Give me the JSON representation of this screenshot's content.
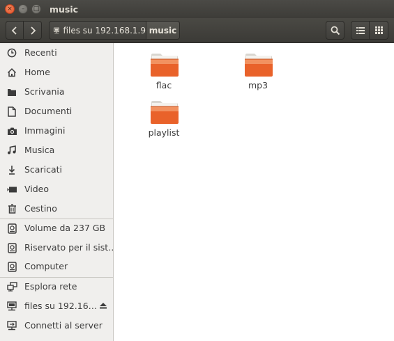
{
  "window": {
    "title": "music",
    "buttons": {
      "close": "×",
      "minimize": "–",
      "maximize": "□"
    }
  },
  "toolbar": {
    "breadcrumb": [
      {
        "label": "files su 192.168.1.9",
        "icon": "network-drive-icon"
      },
      {
        "label": "music",
        "current": true
      }
    ],
    "icons": [
      "back-icon",
      "forward-icon",
      "search-icon",
      "list-view-icon",
      "grid-view-icon"
    ]
  },
  "sidebar": {
    "items": [
      {
        "label": "Recenti",
        "icon": "clock-icon"
      },
      {
        "label": "Home",
        "icon": "home-icon"
      },
      {
        "label": "Scrivania",
        "icon": "desktop-folder-icon"
      },
      {
        "label": "Documenti",
        "icon": "document-icon"
      },
      {
        "label": "Immagini",
        "icon": "camera-icon"
      },
      {
        "label": "Musica",
        "icon": "music-note-icon"
      },
      {
        "label": "Scaricati",
        "icon": "download-icon"
      },
      {
        "label": "Video",
        "icon": "video-icon"
      },
      {
        "label": "Cestino",
        "icon": "trash-icon"
      },
      {
        "label": "Volume da 237 GB",
        "icon": "drive-icon"
      },
      {
        "label": "Riservato per il sist…",
        "icon": "drive-icon"
      },
      {
        "label": "Computer",
        "icon": "drive-icon"
      },
      {
        "label": "Esplora rete",
        "icon": "network-icon"
      },
      {
        "label": "files su 192.16…",
        "icon": "network-drive-icon",
        "eject": true
      },
      {
        "label": "Connetti al server",
        "icon": "server-connect-icon"
      }
    ]
  },
  "files": [
    {
      "name": "flac",
      "type": "folder"
    },
    {
      "name": "mp3",
      "type": "folder"
    },
    {
      "name": "playlist",
      "type": "folder"
    }
  ],
  "colors": {
    "folder": "#e9622a",
    "folder_light": "#f39b6a",
    "titlebar": "#3d3c38",
    "sidebar_bg": "#f0efed"
  }
}
